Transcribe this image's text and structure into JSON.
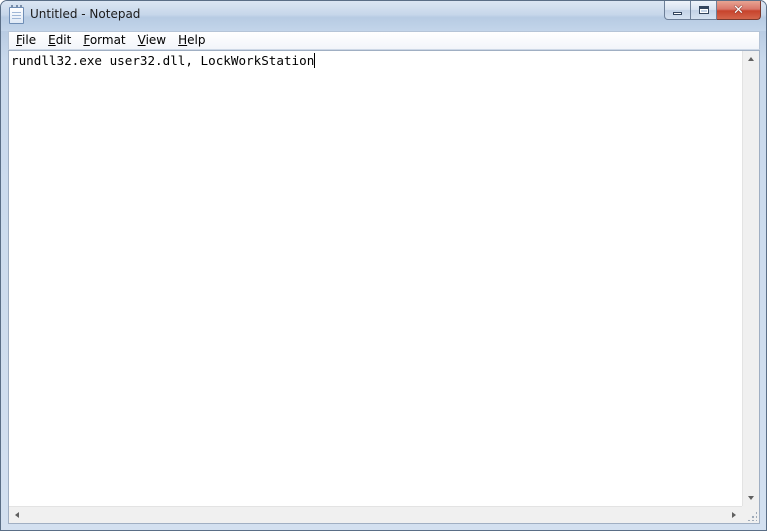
{
  "window": {
    "title": "Untitled - Notepad",
    "icon": "notepad-icon",
    "controls": {
      "minimize": "minimize-icon",
      "maximize": "maximize-icon",
      "close": "✕"
    }
  },
  "menubar": {
    "items": [
      {
        "label": "File",
        "accel": "F",
        "rest": "ile"
      },
      {
        "label": "Edit",
        "accel": "E",
        "rest": "dit"
      },
      {
        "label": "Format",
        "accel": "F",
        "rest": "ormat"
      },
      {
        "label": "View",
        "accel": "V",
        "rest": "iew"
      },
      {
        "label": "Help",
        "accel": "H",
        "rest": "elp"
      }
    ]
  },
  "editor": {
    "text": "rundll32.exe user32.dll, LockWorkStation"
  },
  "colors": {
    "titlebar": "#c7d7ea",
    "close_button": "#c7432c",
    "scrollbar": "#f0f0f0"
  }
}
